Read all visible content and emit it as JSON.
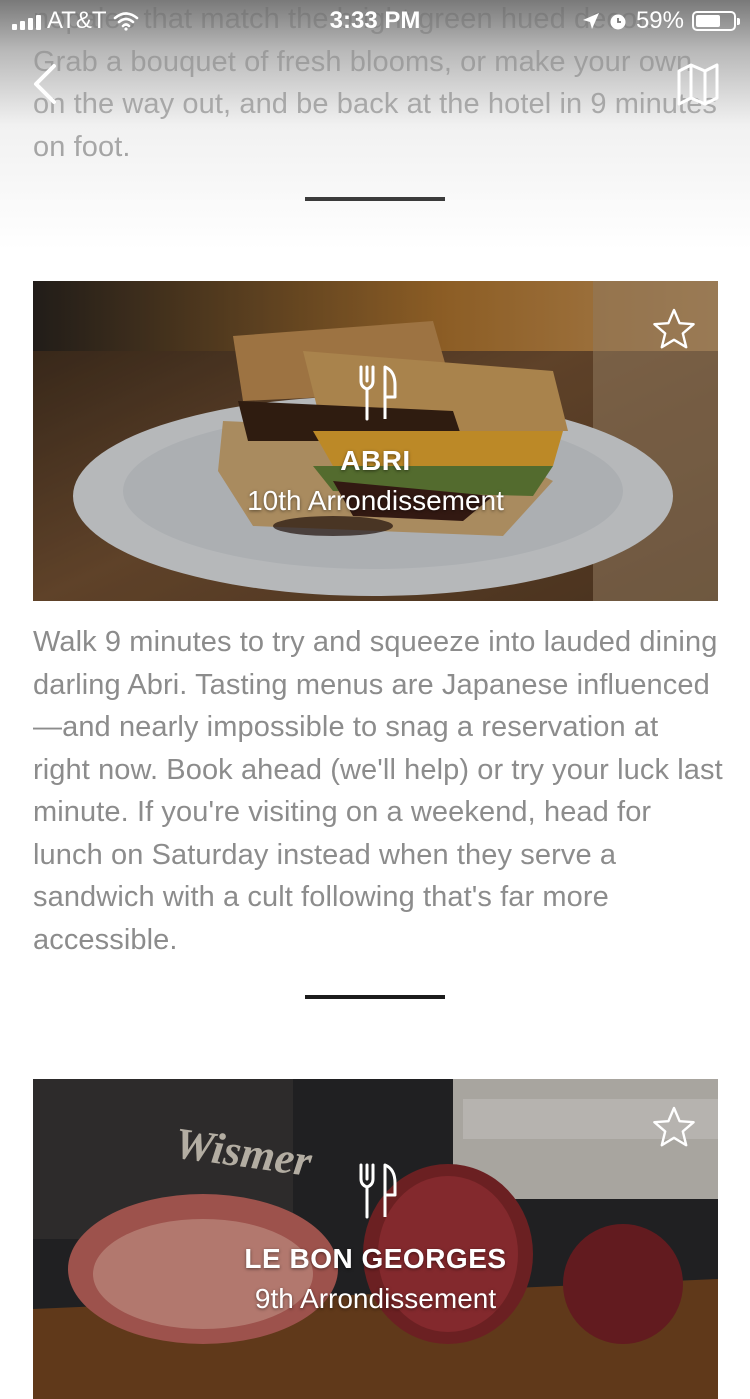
{
  "status_bar": {
    "carrier": "AT&T",
    "time": "3:33 PM",
    "battery": "59%"
  },
  "nav": {
    "back_icon": "chevron-left-icon",
    "map_icon": "map-icon"
  },
  "intro_text": "nopales that match the bright green hued decor. Grab a bouquet of fresh blooms, or make your own on the way out, and be back at the hotel in 9 minutes on foot.",
  "places": [
    {
      "name": "ABRI",
      "area": "10th Arrondissement",
      "category_icon": "fork-knife-icon",
      "favorite_icon": "star-outline-icon",
      "description": "Walk 9 minutes to try and squeeze into lauded dining darling Abri. Tasting menus are Japanese influenced—and nearly impossible to snag a reservation at right now. Book ahead (we'll help) or try your luck last minute. If you're visiting on a weekend, head for lunch on Saturday instead when they serve a sandwich with a cult following that's far more accessible."
    },
    {
      "name": "LE BON GEORGES",
      "area": "9th Arrondissement",
      "category_icon": "fork-knife-icon",
      "favorite_icon": "star-outline-icon",
      "photo_sign": "Wismer"
    }
  ],
  "colors": {
    "body_text": "#8c8c8c",
    "divider": "#1c1c1c",
    "overlay_text": "#ffffff"
  }
}
